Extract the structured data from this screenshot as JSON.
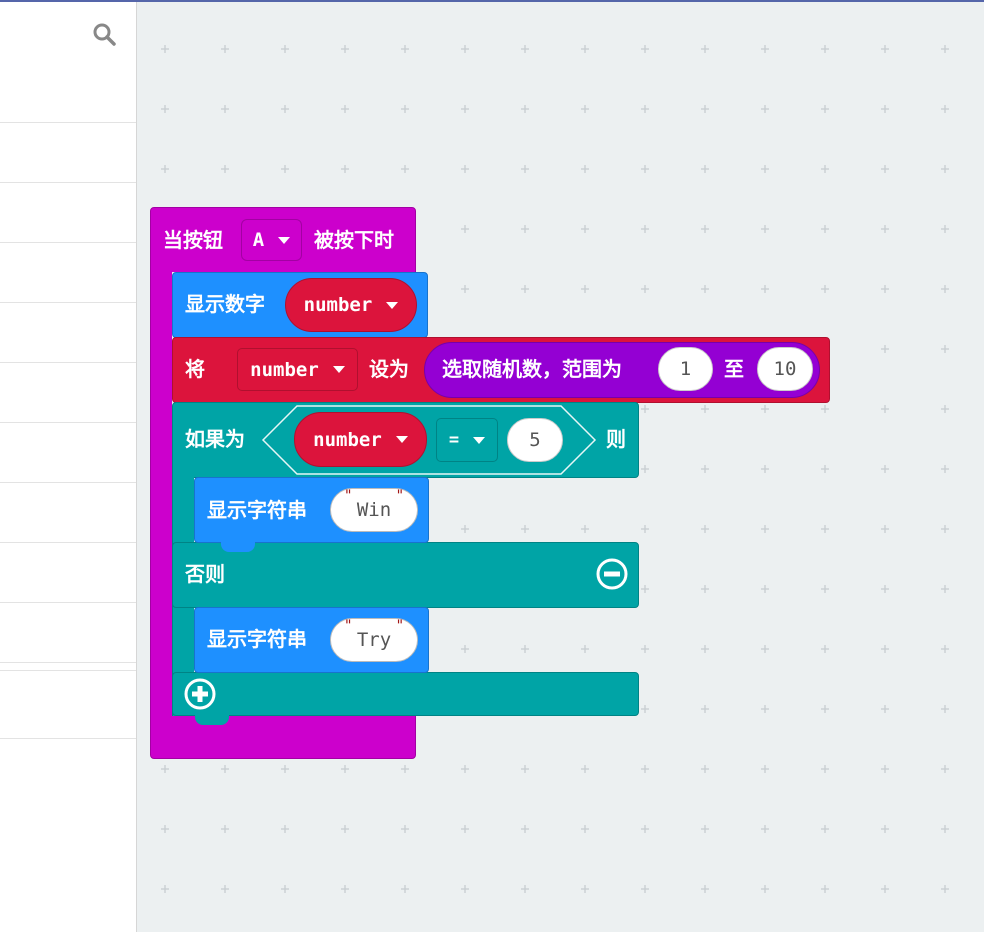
{
  "window": {
    "accent": "#5566aa"
  },
  "toolbox": {
    "search_icon": "search-icon",
    "row_count": 10
  },
  "colors": {
    "event": "#cc00cc",
    "basic": "#1e90ff",
    "variable": "#dc143c",
    "math": "#9400d3",
    "logic": "#00a4a6"
  },
  "blocks": {
    "event": {
      "prefix": "当按钮",
      "button": "A",
      "suffix": "被按下时"
    },
    "show_number": {
      "label": "显示数字",
      "var": "number"
    },
    "set_var": {
      "prefix": "将",
      "var": "number",
      "mid": "设为"
    },
    "random": {
      "label": "选取随机数，范围为",
      "from": "1",
      "to_word": "至",
      "to": "10"
    },
    "if_block": {
      "prefix": "如果为",
      "var": "number",
      "op": "=",
      "value": "5",
      "suffix": "则"
    },
    "show_win": {
      "label": "显示字符串",
      "value": "Win"
    },
    "else_label": "否则",
    "show_try": {
      "label": "显示字符串",
      "value": "Try"
    }
  }
}
